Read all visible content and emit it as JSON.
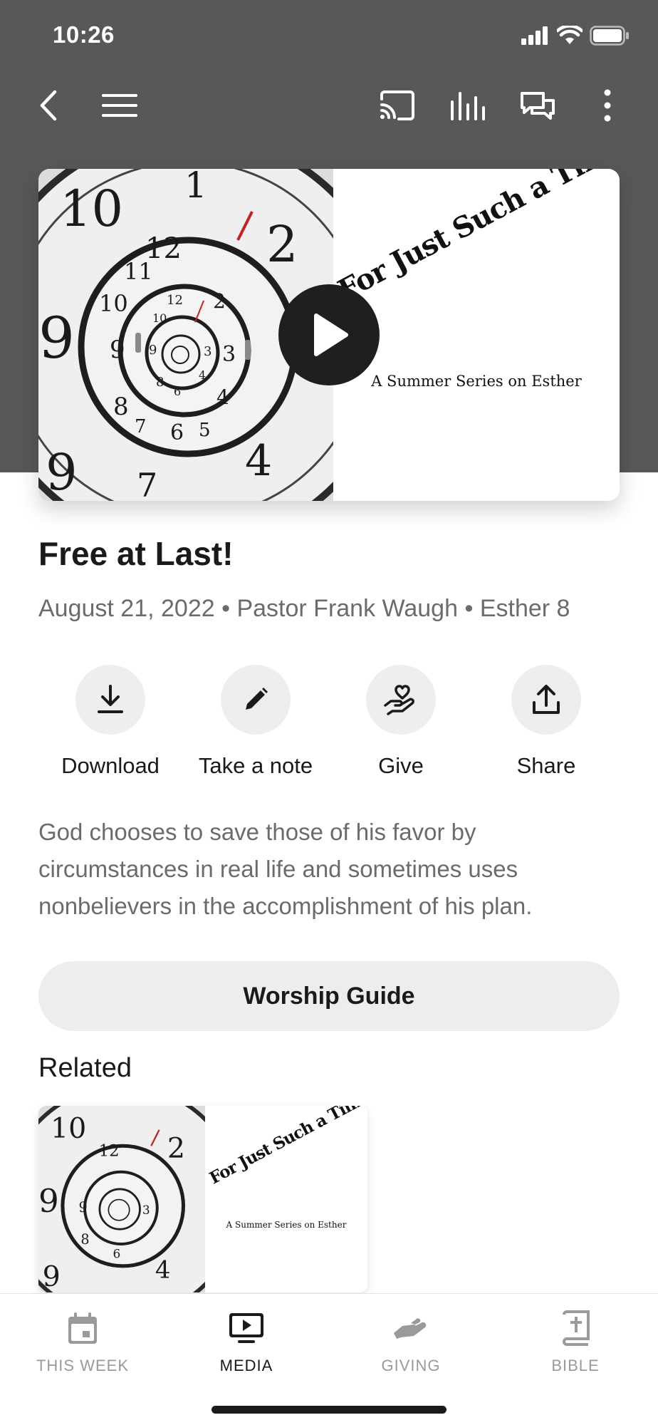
{
  "status": {
    "time": "10:26"
  },
  "toolbar": {
    "back_icon": "chevron-left-icon",
    "menu_icon": "hamburger-icon",
    "cast_icon": "cast-icon",
    "audio_icon": "audio-bars-icon",
    "chat_icon": "chat-bubbles-icon",
    "more_icon": "more-vertical-icon"
  },
  "hero": {
    "series_title": "For Just Such a Time as This!",
    "series_subtitle": "A Summer Series on Esther",
    "play_icon": "play-icon"
  },
  "sermon": {
    "title": "Free at Last!",
    "date": "August 21, 2022",
    "speaker": "Pastor Frank Waugh",
    "passage": "Esther 8",
    "separator": "•",
    "description": "God chooses to save those of his favor by circumstances in real life and sometimes uses nonbelievers in the accomplishment of his plan."
  },
  "actions": [
    {
      "label": "Download",
      "icon": "download-icon"
    },
    {
      "label": "Take a note",
      "icon": "pencil-icon"
    },
    {
      "label": "Give",
      "icon": "hand-heart-icon"
    },
    {
      "label": "Share",
      "icon": "share-icon"
    }
  ],
  "worship_guide": {
    "label": "Worship Guide"
  },
  "related": {
    "heading": "Related",
    "items": [
      {
        "series_title": "For Just Such a Time as This!",
        "series_subtitle": "A Summer Series on Esther"
      }
    ]
  },
  "tabs": [
    {
      "label": "THIS WEEK",
      "icon": "calendar-icon",
      "active": false
    },
    {
      "label": "MEDIA",
      "icon": "tv-play-icon",
      "active": true
    },
    {
      "label": "GIVING",
      "icon": "giving-hand-icon",
      "active": false
    },
    {
      "label": "BIBLE",
      "icon": "bible-icon",
      "active": false
    }
  ],
  "colors": {
    "header_bg": "#5a5856",
    "button_bg": "#eeeeef",
    "text_primary": "#1a1a1a",
    "text_secondary": "#6b6b6b",
    "tab_inactive": "#9a9a9a"
  }
}
